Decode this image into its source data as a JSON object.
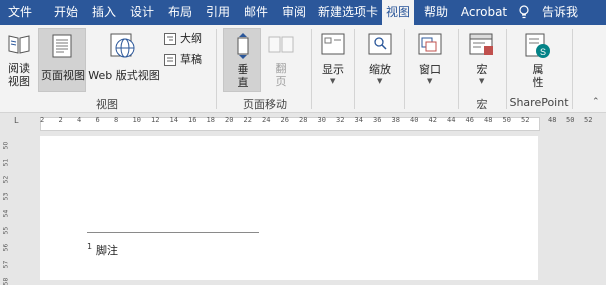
{
  "tabs": [
    {
      "label": "文件"
    },
    {
      "label": "开始"
    },
    {
      "label": "插入"
    },
    {
      "label": "设计"
    },
    {
      "label": "布局"
    },
    {
      "label": "引用"
    },
    {
      "label": "邮件"
    },
    {
      "label": "审阅"
    },
    {
      "label": "新建选项卡"
    },
    {
      "label": "视图",
      "active": true
    },
    {
      "label": "帮助"
    },
    {
      "label": "Acrobat"
    },
    {
      "label": "告诉我"
    }
  ],
  "ribbon": {
    "views_group": {
      "read_mode": "阅读\n视图",
      "print_layout": "页面视图",
      "web_layout": "Web 版式视图",
      "outline": "大纲",
      "draft": "草稿",
      "label": "视图"
    },
    "page_movement_group": {
      "vertical": "垂\n直",
      "side_to_side": "翻\n页",
      "label": "页面移动"
    },
    "show": "显示",
    "zoom": "缩放",
    "window": "窗口",
    "macros": "宏",
    "macros_group": "宏",
    "properties": "属\n性",
    "sharepoint_group": "SharePoint"
  },
  "ruler": {
    "ticks": [
      "2",
      "2",
      "4",
      "6",
      "8",
      "10",
      "12",
      "14",
      "16",
      "18",
      "20",
      "22",
      "24",
      "26",
      "28",
      "30",
      "32",
      "34",
      "36",
      "38",
      "40",
      "42",
      "44",
      "46",
      "48",
      "50",
      "52"
    ],
    "right_ticks": [
      "48",
      "50",
      "52"
    ]
  },
  "vruler": {
    "ticks": [
      "50",
      "51",
      "52",
      "53",
      "54",
      "55",
      "56",
      "57",
      "58"
    ]
  },
  "document": {
    "footnote_number": "1",
    "footnote_text": "脚注"
  },
  "colors": {
    "tab_bar": "#2b579a",
    "ribbon": "#f3f3f3",
    "page": "#ffffff",
    "canvas": "#e6e6e6"
  }
}
